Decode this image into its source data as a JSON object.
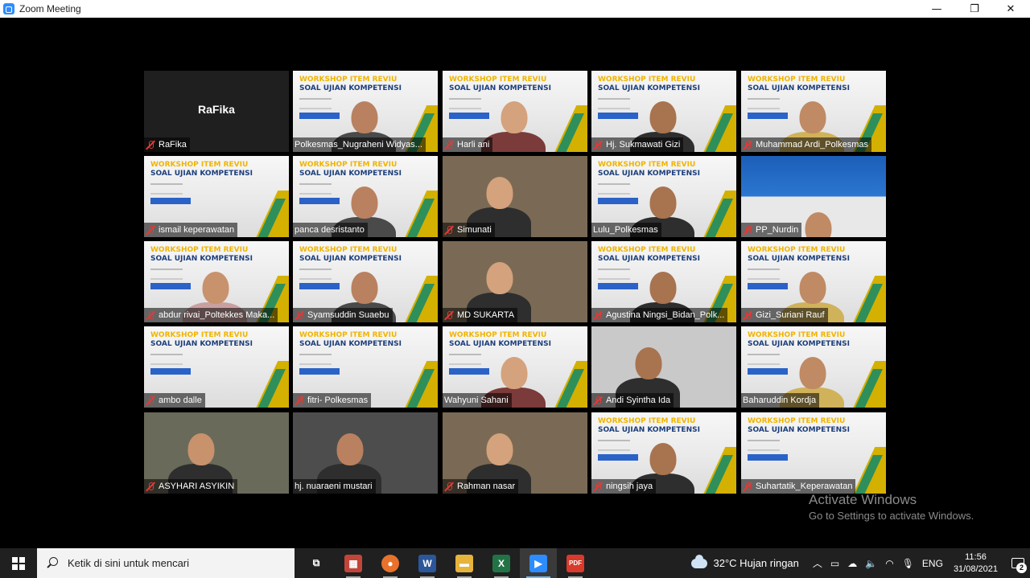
{
  "window": {
    "title": "Zoom Meeting",
    "controls": {
      "minimize": "—",
      "maximize": "❐",
      "close": "✕"
    }
  },
  "participants": [
    {
      "name": "RaFika",
      "display_name": "RaFika",
      "muted": true,
      "video": "off"
    },
    {
      "name": "Polkesmas_Nugraheni Widyas...",
      "muted": false,
      "video": "slide-face",
      "active_speaker": true
    },
    {
      "name": "Harli ani",
      "muted": true,
      "video": "slide-face"
    },
    {
      "name": "Hj. Sukmawati Gizi",
      "muted": true,
      "video": "slide-face"
    },
    {
      "name": "Muhammad Ardi_Polkesmas",
      "muted": true,
      "video": "slide-face"
    },
    {
      "name": "ismail keperawatan",
      "muted": true,
      "video": "slide"
    },
    {
      "name": "panca desristanto",
      "muted": false,
      "video": "slide-face"
    },
    {
      "name": "Simunati",
      "muted": true,
      "video": "face"
    },
    {
      "name": "Lulu_Polkesmas",
      "muted": false,
      "video": "slide-face"
    },
    {
      "name": "PP_Nurdin",
      "muted": true,
      "video": "blue-slide"
    },
    {
      "name": "abdur rivai_Poltekkes Maka...",
      "muted": true,
      "video": "slide-face"
    },
    {
      "name": "Syamsuddin Suaebu",
      "muted": true,
      "video": "slide-face"
    },
    {
      "name": "MD SUKARTA",
      "muted": true,
      "video": "face"
    },
    {
      "name": "Agustina Ningsi_Bidan_Polk...",
      "muted": true,
      "video": "slide-face"
    },
    {
      "name": "Gizi_Suriani Rauf",
      "muted": true,
      "video": "slide-face"
    },
    {
      "name": "ambo dalle",
      "muted": true,
      "video": "slide"
    },
    {
      "name": "fitri- Polkesmas",
      "muted": true,
      "video": "slide"
    },
    {
      "name": "Wahyuni Sahani",
      "muted": false,
      "video": "slide-face"
    },
    {
      "name": "Andi Syintha Ida",
      "muted": true,
      "video": "face"
    },
    {
      "name": "Baharuddin Kordja",
      "muted": false,
      "video": "slide-face"
    },
    {
      "name": "ASYHARI ASYIKIN",
      "muted": true,
      "video": "face"
    },
    {
      "name": "hj. nuaraeni mustari",
      "muted": false,
      "video": "face"
    },
    {
      "name": "Rahman nasar",
      "muted": true,
      "video": "face"
    },
    {
      "name": "ningsih jaya",
      "muted": true,
      "video": "slide-face"
    },
    {
      "name": "Suhartatik_Keperawatan",
      "muted": true,
      "video": "slide"
    }
  ],
  "slide": {
    "line1": "WORKSHOP ITEM REVIU",
    "line2": "SOAL UJIAN KOMPETENSI"
  },
  "watermark": {
    "line1": "Activate Windows",
    "line2": "Go to Settings to activate Windows."
  },
  "taskbar": {
    "search_placeholder": "Ketik di sini untuk mencari",
    "apps": [
      {
        "name": "task-view",
        "label": "⧉"
      },
      {
        "name": "app-photo",
        "label": "▦"
      },
      {
        "name": "firefox",
        "label": "●"
      },
      {
        "name": "word",
        "label": "W"
      },
      {
        "name": "file-explorer",
        "label": "▬"
      },
      {
        "name": "excel",
        "label": "X"
      },
      {
        "name": "zoom",
        "label": "▶"
      },
      {
        "name": "pdf",
        "label": "PDF"
      }
    ],
    "weather": "32°C  Hujan ringan",
    "language": "ENG",
    "time": "11:56",
    "date": "31/08/2021",
    "notifications": "2"
  },
  "colors": {
    "active_speaker": "#c8e04a",
    "muted_icon": "#e53935",
    "slide_title": "#1c3e7a",
    "taskbar": "#202020"
  }
}
